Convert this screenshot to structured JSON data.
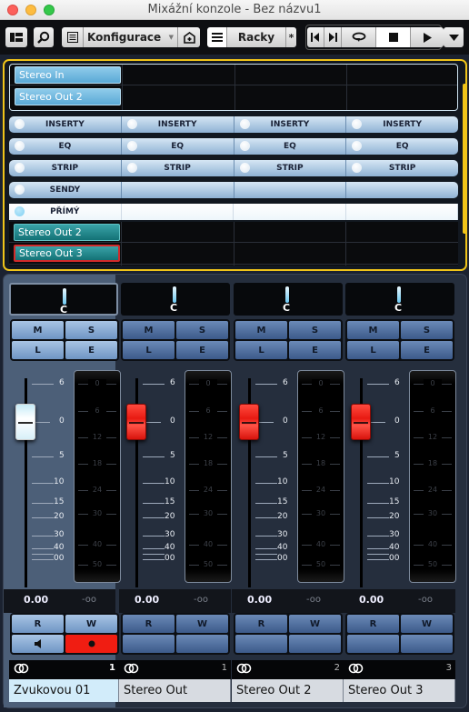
{
  "window": {
    "title": "Mixážní konzole - Bez názvu1"
  },
  "toolbar": {
    "layout_icon": "window-layout-icon",
    "search_icon": "search-icon",
    "list_icon": "list-icon",
    "configuration_label": "Konfigurace",
    "config_store_icon": "store-config-icon",
    "rack_menu_icon": "hamburger-menu-icon",
    "racks_label": "Racky",
    "racks_pin": "*",
    "transport": [
      "go-to-start-icon",
      "go-to-end-icon",
      "cycle-icon",
      "stop-icon",
      "play-icon"
    ],
    "more_icon": "chevron-down-icon"
  },
  "rack": {
    "inputs": [
      "Stereo In",
      "Stereo Out 2"
    ],
    "rows": [
      {
        "name": "inserts",
        "cells": [
          "INSERTY",
          "INSERTY",
          "INSERTY",
          "INSERTY"
        ]
      },
      {
        "name": "eq",
        "cells": [
          "EQ",
          "EQ",
          "EQ",
          "EQ"
        ]
      },
      {
        "name": "strip",
        "cells": [
          "STRIP",
          "STRIP",
          "STRIP",
          "STRIP"
        ]
      },
      {
        "name": "sends",
        "cells": [
          "SENDY",
          "",
          "",
          ""
        ]
      },
      {
        "name": "direct",
        "cells": [
          "PŘÍMÝ",
          "",
          "",
          ""
        ]
      }
    ],
    "outputs": [
      "Stereo Out 2",
      "Stereo Out 3"
    ],
    "selected_output": "Stereo Out 3"
  },
  "mixer": {
    "fader_scale": [
      "6",
      "0",
      "5",
      "10",
      "15",
      "20",
      "30",
      "40",
      "00"
    ],
    "meter_scale": [
      "0",
      "6",
      "12",
      "18",
      "24",
      "30",
      "40",
      "50"
    ],
    "buttons": {
      "mute": "M",
      "solo": "S",
      "listen": "L",
      "edit": "E",
      "read": "R",
      "write": "W"
    },
    "channels": [
      {
        "name": "Zvukovou 01",
        "number": "1",
        "pan": "C",
        "level": "0.00",
        "peak": "-oo",
        "fader_db": 0,
        "selected": true,
        "fader_color": "white",
        "record_armed": true,
        "monitor": true
      },
      {
        "name": "Stereo Out",
        "number": "1",
        "pan": "C",
        "level": "0.00",
        "peak": "-oo",
        "fader_db": 0,
        "selected": false,
        "fader_color": "red",
        "record_armed": false,
        "monitor": false
      },
      {
        "name": "Stereo Out 2",
        "number": "2",
        "pan": "C",
        "level": "0.00",
        "peak": "-oo",
        "fader_db": 0,
        "selected": false,
        "fader_color": "red",
        "record_armed": false,
        "monitor": false
      },
      {
        "name": "Stereo Out 3",
        "number": "3",
        "pan": "C",
        "level": "0.00",
        "peak": "-oo",
        "fader_db": 0,
        "selected": false,
        "fader_color": "red",
        "record_armed": false,
        "monitor": false
      }
    ]
  },
  "colors": {
    "rack_highlight": "#f0c419",
    "record": "#f01d12",
    "fader_red": "#e81a12",
    "routing_blue": "#5aa9d6",
    "output_teal": "#137276"
  }
}
